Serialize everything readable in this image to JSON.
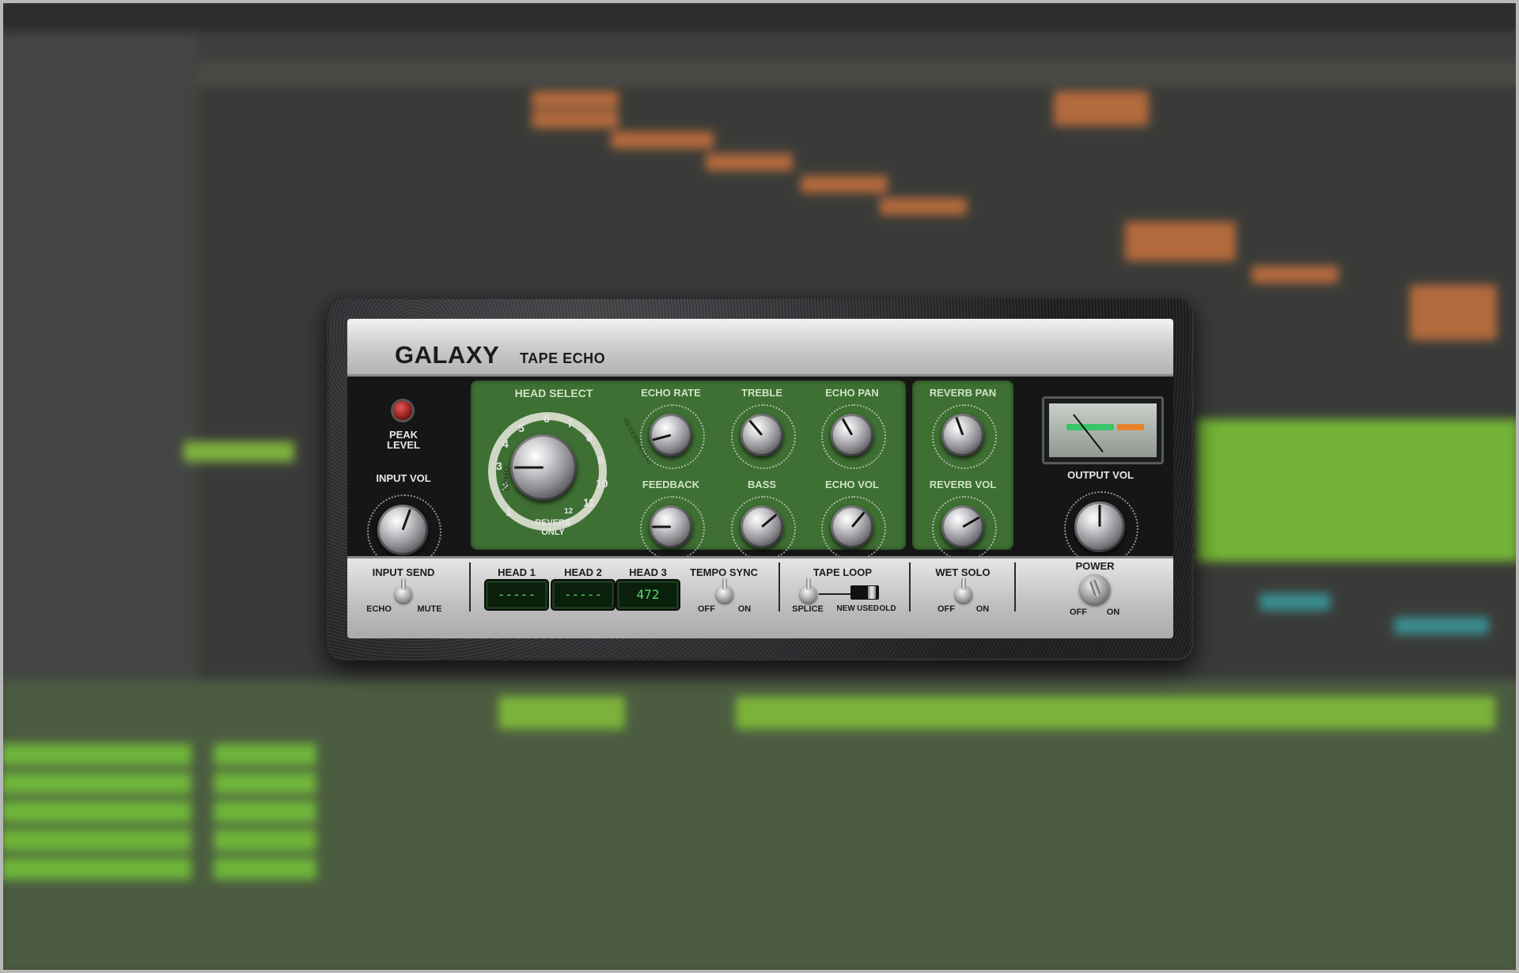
{
  "plugin": {
    "brand": "GALAXY",
    "subtitle": "TAPE ECHO",
    "peak_level_label": "PEAK\nLEVEL",
    "input_vol_label": "INPUT VOL",
    "head_select_label": "HEAD SELECT",
    "head_select_numbers": [
      "1",
      "2",
      "3",
      "4",
      "5",
      "6",
      "7",
      "8",
      "9",
      "10",
      "11",
      "12"
    ],
    "head_select_echo": "ECHO",
    "head_select_reverb_echo": "REVERB ECHO",
    "reverb_only_label": "REVERB\nONLY",
    "knobs": {
      "echo_rate": "ECHO RATE",
      "treble": "TREBLE",
      "echo_pan": "ECHO PAN",
      "feedback": "FEEDBACK",
      "bass": "BASS",
      "echo_vol": "ECHO  VOL",
      "reverb_pan": "REVERB PAN",
      "reverb_vol": "REVERB VOL",
      "output_vol": "OUTPUT VOL"
    },
    "bottom": {
      "input_send": "INPUT SEND",
      "input_send_echo": "ECHO",
      "input_send_mute": "MUTE",
      "head1": "HEAD 1",
      "head2": "HEAD 2",
      "head3": "HEAD 3",
      "head1_value": "-----",
      "head2_value": "-----",
      "head3_value": "472",
      "tempo_sync": "TEMPO SYNC",
      "tempo_off": "OFF",
      "tempo_on": "ON",
      "tape_loop": "TAPE LOOP",
      "tape_splice": "SPLICE",
      "tape_new": "NEW",
      "tape_used": "USED",
      "tape_old": "OLD",
      "wet_solo": "WET SOLO",
      "wet_off": "OFF",
      "wet_on": "ON",
      "power": "POWER",
      "power_off": "OFF",
      "power_on": "ON"
    },
    "colors": {
      "panel_green": "#3e6f33",
      "lcd_text": "#56e06a"
    }
  }
}
